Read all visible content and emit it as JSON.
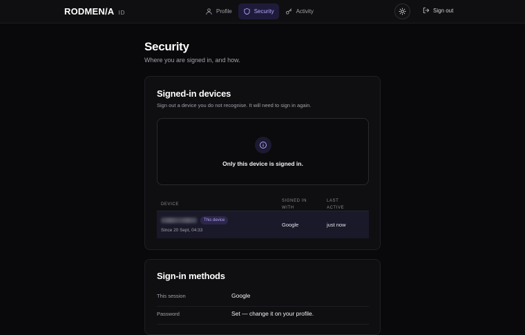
{
  "header": {
    "logo": "RODMEN/A",
    "logo_suffix": "ID",
    "nav": [
      {
        "label": "Profile",
        "icon": "user-icon"
      },
      {
        "label": "Security",
        "icon": "shield-icon",
        "active": true
      },
      {
        "label": "Activity",
        "icon": "key-icon"
      }
    ],
    "theme_icon": "sun-icon",
    "signout_label": "Sign out"
  },
  "page": {
    "title": "Security",
    "subtitle": "Where you are signed in, and how."
  },
  "devices": {
    "title": "Signed-in devices",
    "description": "Sign out a device you do not recognise. It will need to sign in again.",
    "empty_message": "Only this device is signed in.",
    "columns": [
      "DEVICE",
      "SIGNED IN",
      "WITH",
      "LAST",
      "ACTIVE"
    ],
    "rows": [
      {
        "device_badge": "This device",
        "since": "Since 20 Sept, 04:33",
        "with": "Google",
        "last_active": "just now"
      }
    ]
  },
  "methods": {
    "title": "Sign-in methods",
    "rows": [
      {
        "label": "This session",
        "value": "Google"
      },
      {
        "label": "Password",
        "value": "Set — change it on your profile."
      }
    ]
  },
  "colors": {
    "accent": "#b4a5ff",
    "background": "#09090b",
    "card": "#0f0f11"
  }
}
